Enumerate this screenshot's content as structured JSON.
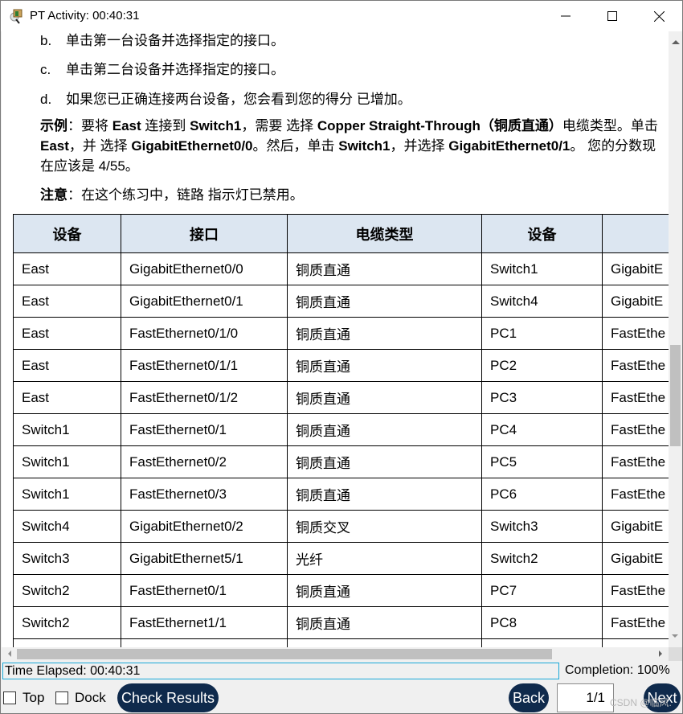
{
  "window": {
    "title": "PT Activity: 00:40:31",
    "icon": "packet-tracer-activity-icon",
    "controls": {
      "minimize": "minimize-icon",
      "maximize": "maximize-icon",
      "close": "close-icon"
    }
  },
  "instructions": {
    "steps": [
      {
        "letter": "b.",
        "text": "单击第一台设备并选择指定的接口。"
      },
      {
        "letter": "c.",
        "text": "单击第二台设备并选择指定的接口。"
      },
      {
        "letter": "d.",
        "text": "如果您已正确连接两台设备，您会看到您的得分 已增加。"
      }
    ],
    "example": {
      "label": "示例",
      "t1": "：要将 ",
      "b1": "East",
      "t2": " 连接到 ",
      "b2": "Switch1",
      "t3": "，需要 选择 ",
      "b3": "Copper Straight-Through（铜质直通）",
      "t4": "电缆类型。单击 ",
      "b4": "East",
      "t5": "，并 选择 ",
      "b5": "GigabitEthernet0/0",
      "t6": "。然后，单击 ",
      "b6": "Switch1",
      "t7": "，并选择 ",
      "b7": "GigabitEthernet0/1",
      "t8": "。 您的分数现在应该是 4/55。"
    },
    "note": {
      "label": "注意",
      "text": "：在这个练习中，链路 指示灯已禁用。"
    }
  },
  "table": {
    "headers": [
      "设备",
      "接口",
      "电缆类型",
      "设备",
      ""
    ],
    "rows": [
      [
        "East",
        "GigabitEthernet0/0",
        "铜质直通",
        "Switch1",
        "GigabitE"
      ],
      [
        "East",
        "GigabitEthernet0/1",
        "铜质直通",
        "Switch4",
        "GigabitE"
      ],
      [
        "East",
        "FastEthernet0/1/0",
        "铜质直通",
        "PC1",
        "FastEthe"
      ],
      [
        "East",
        "FastEthernet0/1/1",
        "铜质直通",
        "PC2",
        "FastEthe"
      ],
      [
        "East",
        "FastEthernet0/1/2",
        "铜质直通",
        "PC3",
        "FastEthe"
      ],
      [
        "Switch1",
        "FastEthernet0/1",
        "铜质直通",
        "PC4",
        "FastEthe"
      ],
      [
        "Switch1",
        "FastEthernet0/2",
        "铜质直通",
        "PC5",
        "FastEthe"
      ],
      [
        "Switch1",
        "FastEthernet0/3",
        "铜质直通",
        "PC6",
        "FastEthe"
      ],
      [
        "Switch4",
        "GigabitEthernet0/2",
        "铜质交叉",
        "Switch3",
        "GigabitE"
      ],
      [
        "Switch3",
        "GigabitEthernet5/1",
        "光纤",
        "Switch2",
        "GigabitE"
      ],
      [
        "Switch2",
        "FastEthernet0/1",
        "铜质直通",
        "PC7",
        "FastEthe"
      ],
      [
        "Switch2",
        "FastEthernet1/1",
        "铜质直通",
        "PC8",
        "FastEthe"
      ],
      [
        "",
        "",
        "",
        "",
        ""
      ]
    ]
  },
  "footer": {
    "time_elapsed": "Time Elapsed: 00:40:31",
    "completion": "Completion: 100%",
    "top_label": "Top",
    "top_checked": false,
    "dock_label": "Dock",
    "dock_checked": false,
    "check_results_label": "Check Results",
    "back_label": "Back",
    "page_indicator": "1/1",
    "next_label": "Next",
    "watermark": "CSDN @临风."
  },
  "colors": {
    "button_bg": "#0f2a4c",
    "header_bg": "#dce6f1",
    "time_border": "#1aa9d8"
  }
}
